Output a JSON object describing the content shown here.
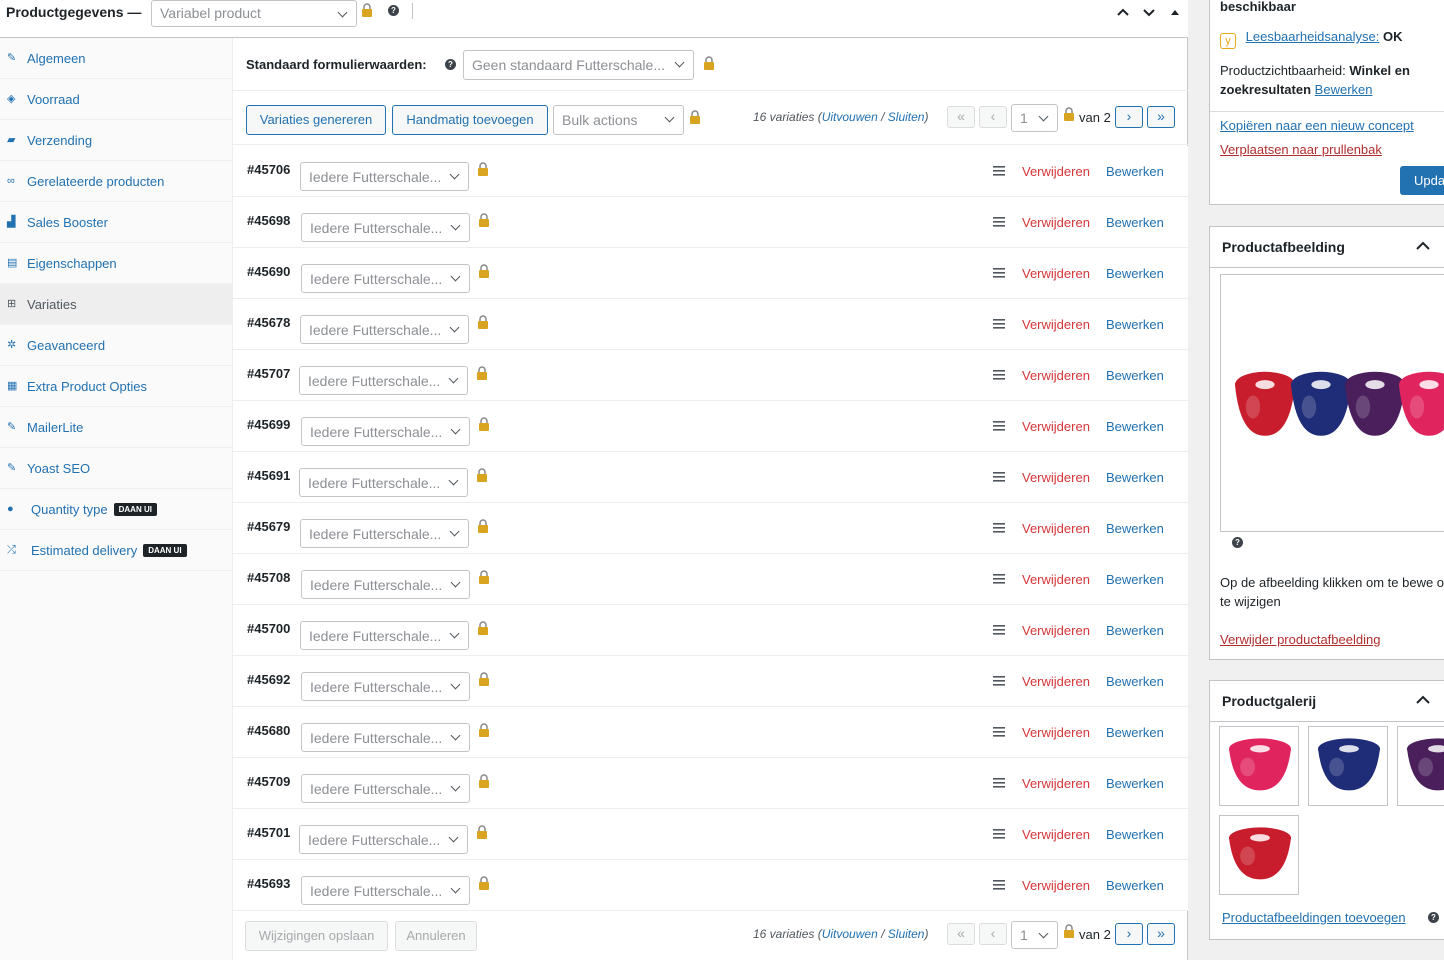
{
  "header": {
    "title": "Productgegevens —",
    "product_type": "Variabel product"
  },
  "sidebar": {
    "items": [
      {
        "label": "Algemeen",
        "icon": "wrench-icon"
      },
      {
        "label": "Voorraad",
        "icon": "tag-icon"
      },
      {
        "label": "Verzending",
        "icon": "truck-icon"
      },
      {
        "label": "Gerelateerde producten",
        "icon": "link-icon"
      },
      {
        "label": "Sales Booster",
        "icon": "chart-icon"
      },
      {
        "label": "Eigenschappen",
        "icon": "list-icon"
      },
      {
        "label": "Variaties",
        "icon": "grid-icon"
      },
      {
        "label": "Geavanceerd",
        "icon": "gear-icon"
      },
      {
        "label": "Extra Product Opties",
        "icon": "blocks-icon"
      },
      {
        "label": "MailerLite",
        "icon": "wrench-icon"
      },
      {
        "label": "Yoast SEO",
        "icon": "wrench-icon"
      },
      {
        "label": "Quantity type",
        "icon": "dot-icon",
        "badge": "DAAN UI"
      },
      {
        "label": "Estimated delivery",
        "icon": "shuffle-icon",
        "badge": "DAAN UI"
      }
    ]
  },
  "defaults": {
    "label": "Standaard formulierwaarden:",
    "value": "Geen standaard Futterschale..."
  },
  "toolbar": {
    "generate": "Variaties genereren",
    "add_manual": "Handmatig toevoegen",
    "bulk": "Bulk actions"
  },
  "pagination": {
    "count": "16 variaties",
    "expand": "Uitvouwen",
    "sep": "/",
    "collapse": "Sluiten",
    "page": "1",
    "of": "van 2",
    "first": "«",
    "prev": "‹",
    "next": "›",
    "last": "»"
  },
  "row_select": "Iedere Futterschale...",
  "row_delete": "Verwijderen",
  "row_edit": "Bewerken",
  "variations": [
    "#45706",
    "#45698",
    "#45690",
    "#45678",
    "#45707",
    "#45699",
    "#45691",
    "#45679",
    "#45708",
    "#45700",
    "#45692",
    "#45680",
    "#45709",
    "#45701",
    "#45693"
  ],
  "footer": {
    "save": "Wijzigingen opslaan",
    "cancel": "Annuleren"
  },
  "publish": {
    "available": "beschikbaar",
    "readability_link": "Leesbaarheidsanalyse:",
    "readability_value": "OK",
    "visibility_label": "Productzichtbaarheid:",
    "visibility_value": "Winkel en zoekresultaten",
    "visibility_edit": "Bewerken",
    "copy": "Kopiëren naar een nieuw concept",
    "trash": "Verplaatsen naar prullenbak",
    "update": "Upda"
  },
  "image_box": {
    "title": "Productafbeelding",
    "help_text": "Op de afbeelding klikken om te bewe of te wijzigen",
    "remove": "Verwijder productafbeelding"
  },
  "gallery": {
    "title": "Productgalerij",
    "add": "Productafbeeldingen toevoegen"
  },
  "colors": {
    "accent": "#2271b1",
    "danger": "#d63638",
    "tub_colors": [
      "#c81d2c",
      "#1f2c78",
      "#4a1f5c",
      "#e0245e"
    ]
  }
}
